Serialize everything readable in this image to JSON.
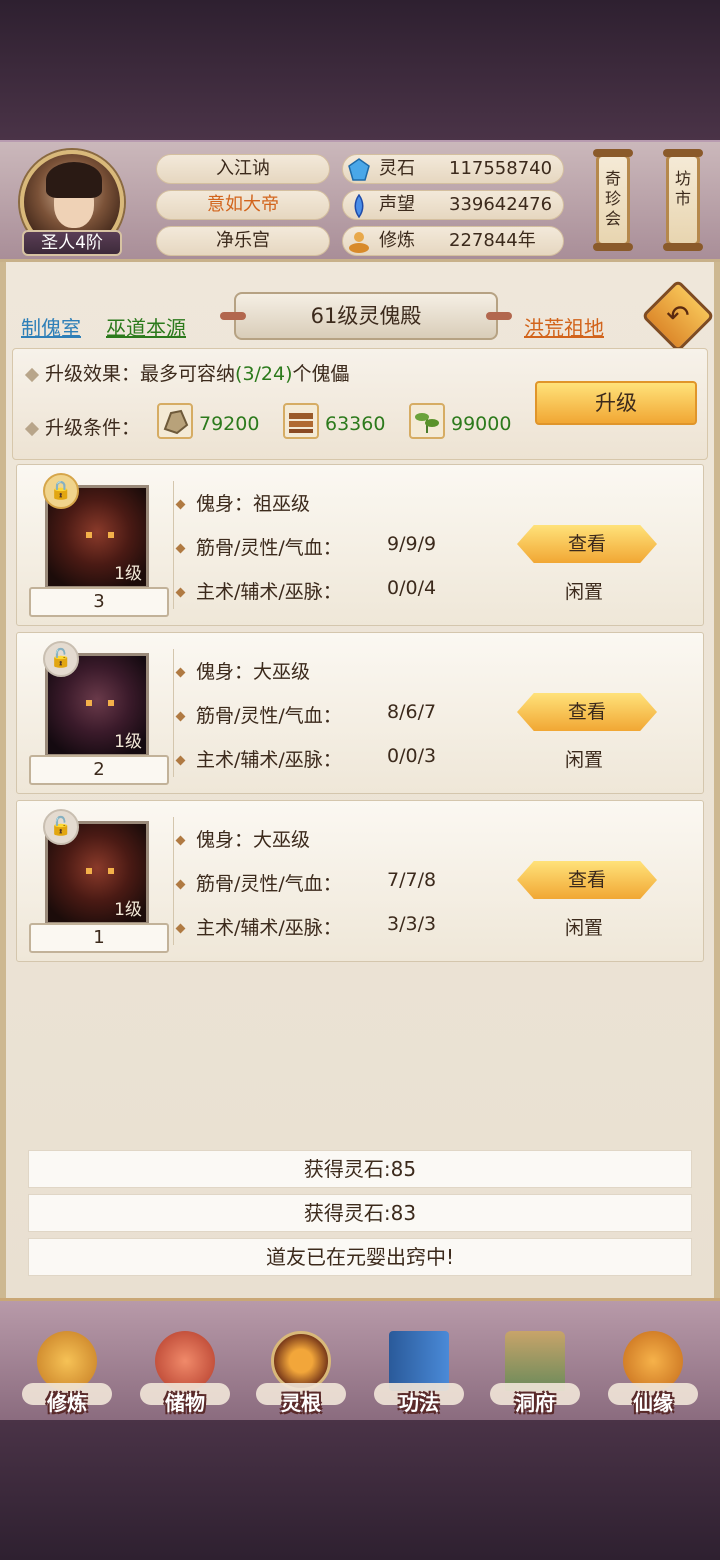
{
  "player": {
    "rank": "圣人4阶",
    "names": [
      "入江讷",
      "意如大帝",
      "净乐宫"
    ]
  },
  "resources": [
    {
      "icon": "spirit-stone-icon",
      "label": "灵石",
      "value": "117558740"
    },
    {
      "icon": "fame-icon",
      "label": "声望",
      "value": "339642476"
    },
    {
      "icon": "cultivation-icon",
      "label": "修炼",
      "value": "227844年"
    }
  ],
  "side_buttons": {
    "treasure": "奇珍会",
    "market": "坊市"
  },
  "nav": {
    "left1": "制傀室",
    "left2": "巫道本源",
    "title": "61级灵傀殿",
    "right": "洪荒祖地"
  },
  "upgrade": {
    "effect_label": "升级效果：",
    "effect_prefix": "最多可容纳",
    "effect_count": "(3/24)",
    "effect_suffix": "个傀儡",
    "cond_label": "升级条件：",
    "materials": [
      {
        "icon": "ore-icon",
        "value": "79200"
      },
      {
        "icon": "wood-icon",
        "value": "63360"
      },
      {
        "icon": "herb-icon",
        "value": "99000"
      }
    ],
    "button": "升级"
  },
  "puppets": [
    {
      "number": "3",
      "level": "1级",
      "body_label": "傀身：",
      "body": "祖巫级",
      "stats_label": "筋骨/灵性/气血：",
      "stats": "9/9/9",
      "arts_label": "主术/辅术/巫脉：",
      "arts": "0/0/4",
      "view": "查看",
      "status": "闲置"
    },
    {
      "number": "2",
      "level": "1级",
      "body_label": "傀身：",
      "body": "大巫级",
      "stats_label": "筋骨/灵性/气血：",
      "stats": "8/6/7",
      "arts_label": "主术/辅术/巫脉：",
      "arts": "0/0/3",
      "view": "查看",
      "status": "闲置"
    },
    {
      "number": "1",
      "level": "1级",
      "body_label": "傀身：",
      "body": "大巫级",
      "stats_label": "筋骨/灵性/气血：",
      "stats": "7/7/8",
      "arts_label": "主术/辅术/巫脉：",
      "arts": "3/3/3",
      "view": "查看",
      "status": "闲置"
    }
  ],
  "log": [
    "获得灵石:85",
    "获得灵石:83",
    "道友已在元婴出窍中!"
  ],
  "bottom_nav": [
    "修炼",
    "储物",
    "灵根",
    "功法",
    "洞府",
    "仙缘"
  ],
  "colors": {
    "accent_orange": "#d2641c",
    "link_blue": "#2e7fb8",
    "link_green": "#2c7a1c",
    "gold": "#f1a734"
  }
}
